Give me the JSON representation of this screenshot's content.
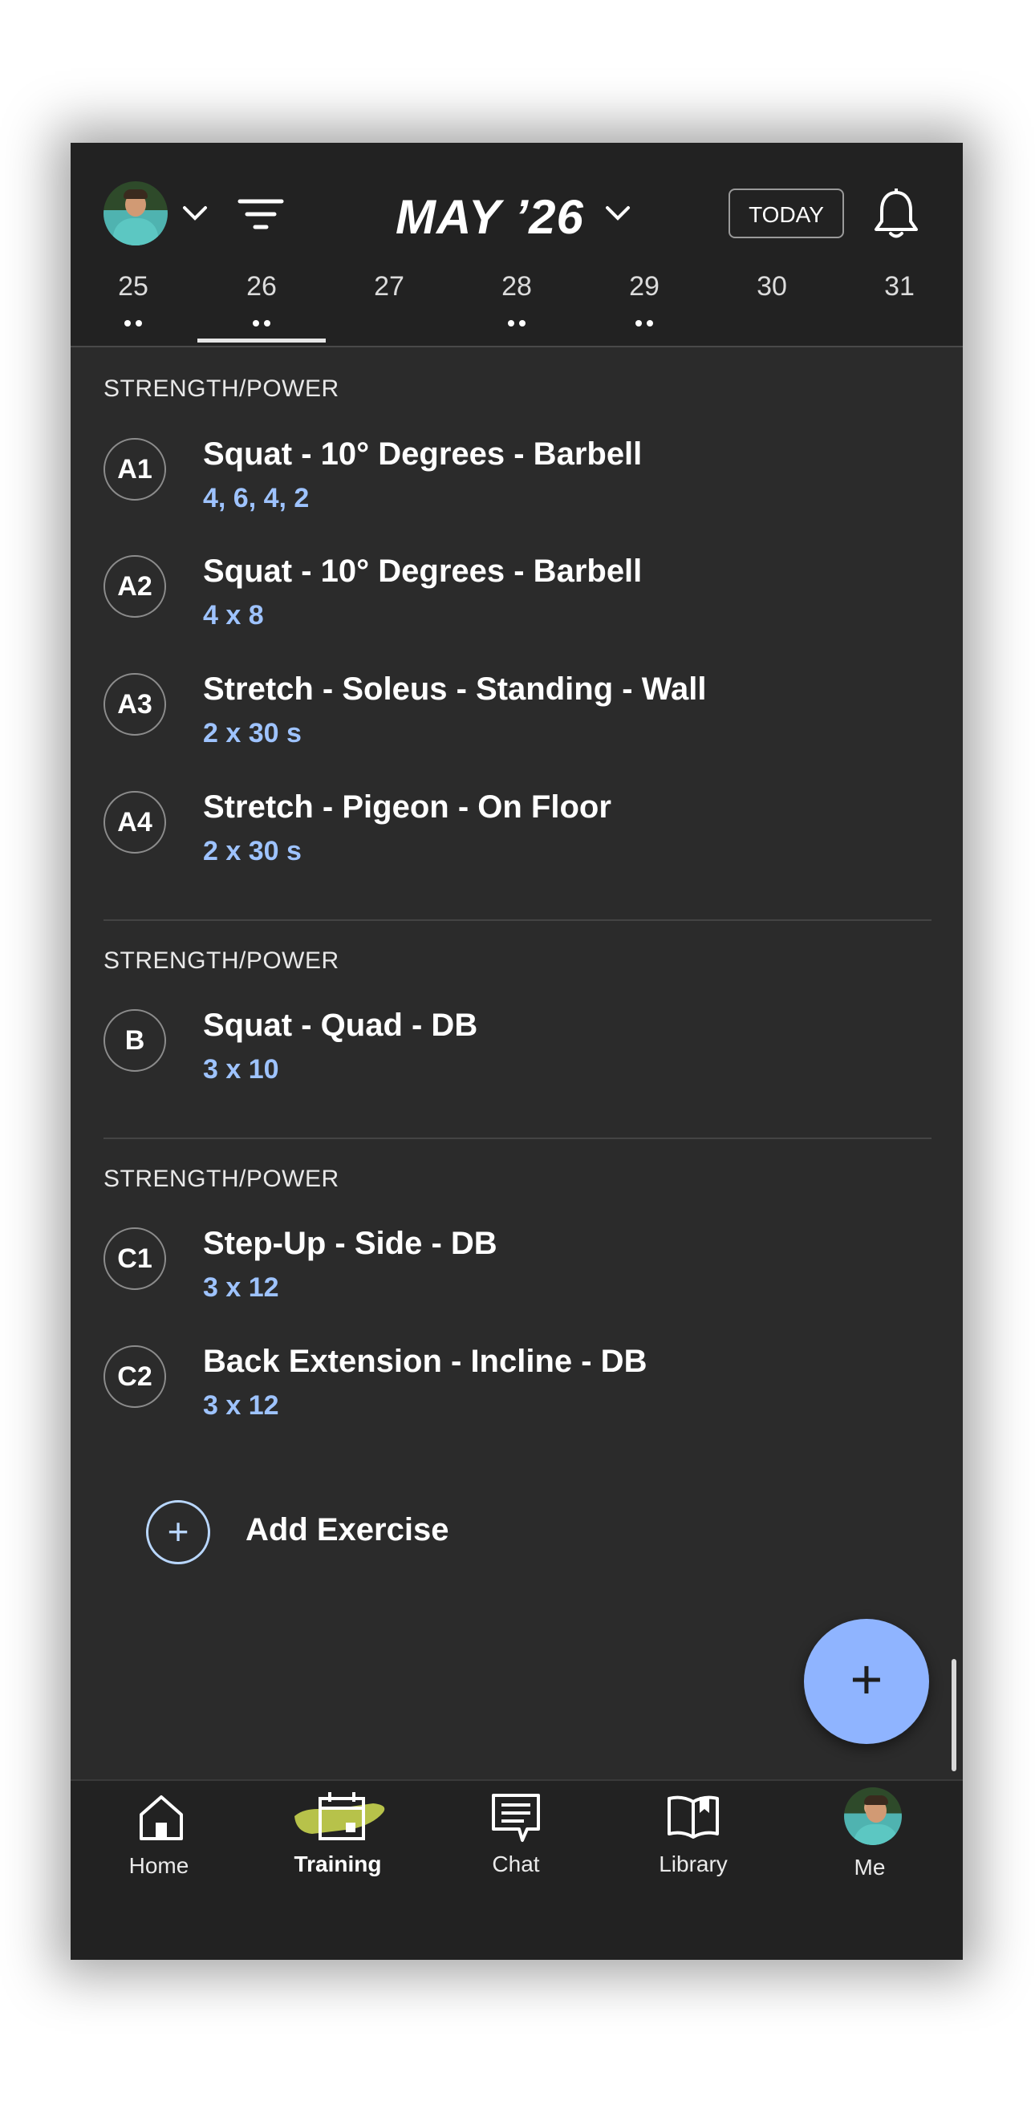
{
  "header": {
    "month_title": "MAY ’26",
    "today_label": "TODAY",
    "icons": [
      "avatar",
      "chevron-down-icon",
      "filter-icon",
      "chevron-down-icon",
      "bell-icon"
    ]
  },
  "days": [
    {
      "num": "25",
      "dots": 2
    },
    {
      "num": "26",
      "dots": 2,
      "selected": true
    },
    {
      "num": "27",
      "dots": 0
    },
    {
      "num": "28",
      "dots": 2
    },
    {
      "num": "29",
      "dots": 2
    },
    {
      "num": "30",
      "dots": 0
    },
    {
      "num": "31",
      "dots": 0
    }
  ],
  "sections": [
    {
      "label": "STRENGTH/POWER",
      "exercises": [
        {
          "badge": "A1",
          "name": "Squat - 10° Degrees - Barbell",
          "sets": "4, 6, 4, 2"
        },
        {
          "badge": "A2",
          "name": "Squat - 10° Degrees - Barbell",
          "sets": "4 x 8"
        },
        {
          "badge": "A3",
          "name": "Stretch - Soleus - Standing - Wall",
          "sets": "2 x 30 s"
        },
        {
          "badge": "A4",
          "name": "Stretch - Pigeon - On Floor",
          "sets": "2 x 30 s"
        }
      ]
    },
    {
      "label": "STRENGTH/POWER",
      "exercises": [
        {
          "badge": "B",
          "name": "Squat - Quad - DB",
          "sets": "3 x 10"
        }
      ]
    },
    {
      "label": "STRENGTH/POWER",
      "exercises": [
        {
          "badge": "C1",
          "name": "Step-Up - Side - DB",
          "sets": "3 x 12"
        },
        {
          "badge": "C2",
          "name": "Back Extension - Incline - DB",
          "sets": "3 x 12"
        }
      ]
    }
  ],
  "add_exercise": {
    "label": "Add Exercise",
    "icon": "plus-circle-icon"
  },
  "fab": {
    "icon": "plus-icon",
    "color": "#8fb4ff"
  },
  "nav": [
    {
      "label": "Home",
      "icon": "home-icon"
    },
    {
      "label": "Training",
      "icon": "calendar-icon",
      "active": true,
      "accent": "#b7c24a"
    },
    {
      "label": "Chat",
      "icon": "chat-icon"
    },
    {
      "label": "Library",
      "icon": "book-icon"
    },
    {
      "label": "Me",
      "icon": "avatar"
    }
  ],
  "colors": {
    "background": "#2b2b2b",
    "header": "#222222",
    "sets_text": "#9ec3ff",
    "accent_fab": "#8fb4ff"
  }
}
